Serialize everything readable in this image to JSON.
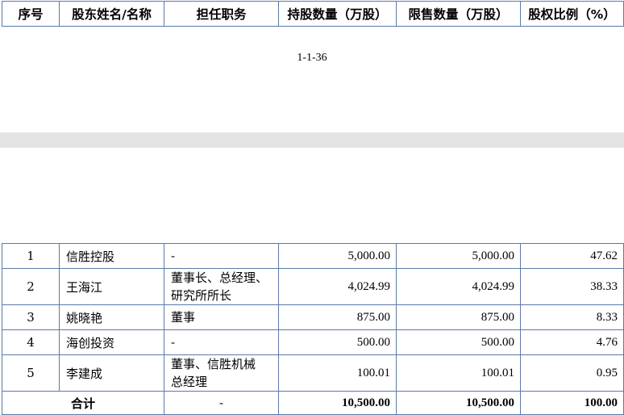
{
  "header": {
    "columns": [
      "序号",
      "股东姓名/名称",
      "担任职务",
      "持股数量（万股）",
      "限售数量（万股）",
      "股权比例（%）"
    ]
  },
  "page_footer": "1-1-36",
  "rows": [
    {
      "no": "1",
      "name": "信胜控股",
      "position": [
        "-"
      ],
      "shares": "5,000.00",
      "restricted": "5,000.00",
      "ratio": "47.62"
    },
    {
      "no": "2",
      "name": "王海江",
      "position": [
        "董事长、总经理、",
        "研究所所长"
      ],
      "shares": "4,024.99",
      "restricted": "4,024.99",
      "ratio": "38.33"
    },
    {
      "no": "3",
      "name": "姚晓艳",
      "position": [
        "董事"
      ],
      "shares": "875.00",
      "restricted": "875.00",
      "ratio": "8.33"
    },
    {
      "no": "4",
      "name": "海创投资",
      "position": [
        "-"
      ],
      "shares": "500.00",
      "restricted": "500.00",
      "ratio": "4.76"
    },
    {
      "no": "5",
      "name": "李建成",
      "position": [
        "董事、信胜机械",
        "总经理"
      ],
      "shares": "100.01",
      "restricted": "100.01",
      "ratio": "0.95"
    }
  ],
  "total": {
    "label": "合计",
    "position": "-",
    "shares": "10,500.00",
    "restricted": "10,500.00",
    "ratio": "100.00"
  }
}
